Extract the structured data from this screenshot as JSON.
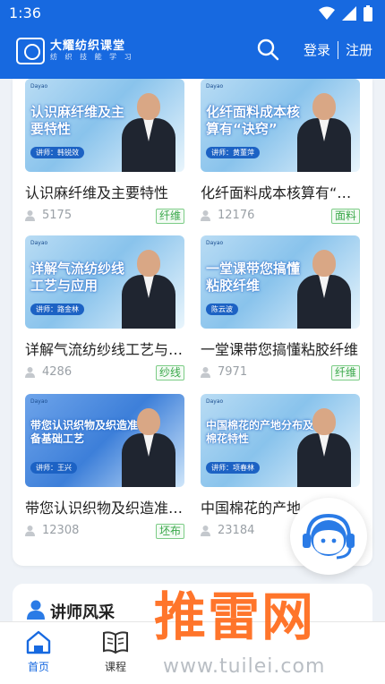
{
  "status_bar": {
    "time": "1:36"
  },
  "header": {
    "app_title": "大耀纺织课堂",
    "app_subtitle": "纺 织 技 能 学 习",
    "login": "登录",
    "register": "注册"
  },
  "courses": [
    {
      "thumb_title": "认识麻纤维及主要特性",
      "thumb_lecturer": "讲师：韩锐效",
      "title": "认识麻纤维及主要特性",
      "views": "5175",
      "tag": "纤维"
    },
    {
      "thumb_title": "化纤面料成本核算有“诀窍”",
      "thumb_lecturer": "讲师：黄董萍",
      "title": "化纤面料成本核算有“诀窍”",
      "views": "12176",
      "tag": "面料"
    },
    {
      "thumb_title": "详解气流纺纱线工艺与应用",
      "thumb_lecturer": "讲师：路金林",
      "title": "详解气流纺纱线工艺与应用",
      "views": "4286",
      "tag": "纱线"
    },
    {
      "thumb_title": "一堂课带您搞懂粘胶纤维",
      "thumb_lecturer": "陈云波",
      "title": "一堂课带您搞懂粘胶纤维",
      "views": "7971",
      "tag": "纤维"
    },
    {
      "thumb_title": "带您认识织物及织造准备基础工艺",
      "thumb_lecturer": "讲师：王兴",
      "title": "带您认识织物及织造准备基础工艺",
      "views": "12308",
      "tag": "坯布"
    },
    {
      "thumb_title": "中国棉花的产地分布及棉花特性",
      "thumb_lecturer": "讲师：项春林",
      "title": "中国棉花的产地分布及棉花特性",
      "views": "23184",
      "tag": ""
    }
  ],
  "lecturer_section": {
    "title": "讲师风采"
  },
  "watermark": {
    "big": "推雷网",
    "url": "www.tuilei.com"
  },
  "bottom_nav": {
    "home": "首页",
    "course": "课程"
  },
  "colors": {
    "primary": "#1769e0",
    "tag_green": "#3aa84a",
    "watermark_orange": "#ff6a1a"
  }
}
